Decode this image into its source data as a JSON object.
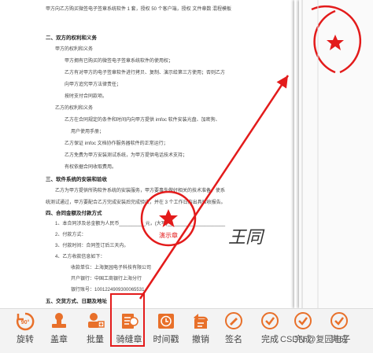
{
  "document": {
    "lines": [
      {
        "text": "甲方向乙方购买微签电子签章系统软件 1 套，授权 50 个客户端，授权 文件章数 混程模板",
        "sec": false
      },
      {
        "text": "二、双方的权利和义务",
        "sec": true
      },
      {
        "text": "甲方的权利和义务",
        "sec": false
      },
      {
        "text": "甲方拥有已购买的微签电子签章系统软件的使用权；",
        "sec": false
      },
      {
        "text": "乙方有对甲方的电子签章软件进行拷贝、复制、演示给第三方使用；否则乙方",
        "sec": false
      },
      {
        "text": "向甲方追究甲方法律责任；",
        "sec": false
      },
      {
        "text": "按时支付合同款项。",
        "sec": false
      },
      {
        "text": "乙方的权利和义务",
        "sec": false
      },
      {
        "text": "乙方在合同规定的条件和时间内向甲方提供 imfoc 软件安装光盘、加密狗、",
        "sec": false
      },
      {
        "text": "用户使用手册；",
        "sec": false
      },
      {
        "text": "乙方保证 imfoc 文档协作服务器软件的正常运行；",
        "sec": false
      },
      {
        "text": "乙方免费为甲方安装测试系统，为甲方提供电话技术支持；",
        "sec": false
      },
      {
        "text": "有权依据合同收取费用。",
        "sec": false
      },
      {
        "text": "三、软件系统的安装和验收",
        "sec": true
      },
      {
        "text": "乙方为甲方提供所购软件系统的安装服务，甲方要事先做好相关的技术准备，使系",
        "sec": false
      },
      {
        "text": "统测试通过，甲方要配合乙方完成安装后完成验收，并在 3 个工作日内出具验收报告。",
        "sec": false
      },
      {
        "text": "四、合同金额及付款方式",
        "sec": true
      },
      {
        "text": "1、本合同涉及总金额为人民币__________元，(大写)______________________",
        "sec": false
      },
      {
        "text": "2、付款方式：",
        "sec": false
      },
      {
        "text": "3、付款时间：合同签订后三天内。",
        "sec": false
      },
      {
        "text": "4、乙方收款信息如下：",
        "sec": false
      },
      {
        "text": "收款单位：上海复园电子科技有限公司",
        "sec": false
      },
      {
        "text": "开户银行：中国工商银行上海分行",
        "sec": false
      },
      {
        "text": "银行账号：1001224909300065531",
        "sec": false
      },
      {
        "text": "五、交货方式、日期及地址",
        "sec": true
      }
    ],
    "stamp_text": "演示章",
    "stamp_ring_text": "子签章测",
    "signature": "王同"
  },
  "toolbar": {
    "tools": [
      {
        "label": "旋转",
        "icon": "rotate-90-icon",
        "badge": "90°"
      },
      {
        "label": "盖章",
        "icon": "stamp-icon"
      },
      {
        "label": "批量",
        "icon": "batch-icon"
      },
      {
        "label": "骑缝章",
        "icon": "perforation-seal-icon"
      },
      {
        "label": "时间戳",
        "icon": "timestamp-icon"
      },
      {
        "label": "撤销",
        "icon": "undo-icon"
      },
      {
        "label": "签名",
        "icon": "signature-icon"
      },
      {
        "label": "完成",
        "icon": "check-icon"
      },
      {
        "label": "完成",
        "icon": "check-icon"
      },
      {
        "label": "完成",
        "icon": "check-icon"
      }
    ]
  },
  "watermark": "CSDN @复园电子",
  "colors": {
    "accent": "#e8702a",
    "stamp": "#e31b1b",
    "toolbar_bg": "#f3f3f3"
  }
}
